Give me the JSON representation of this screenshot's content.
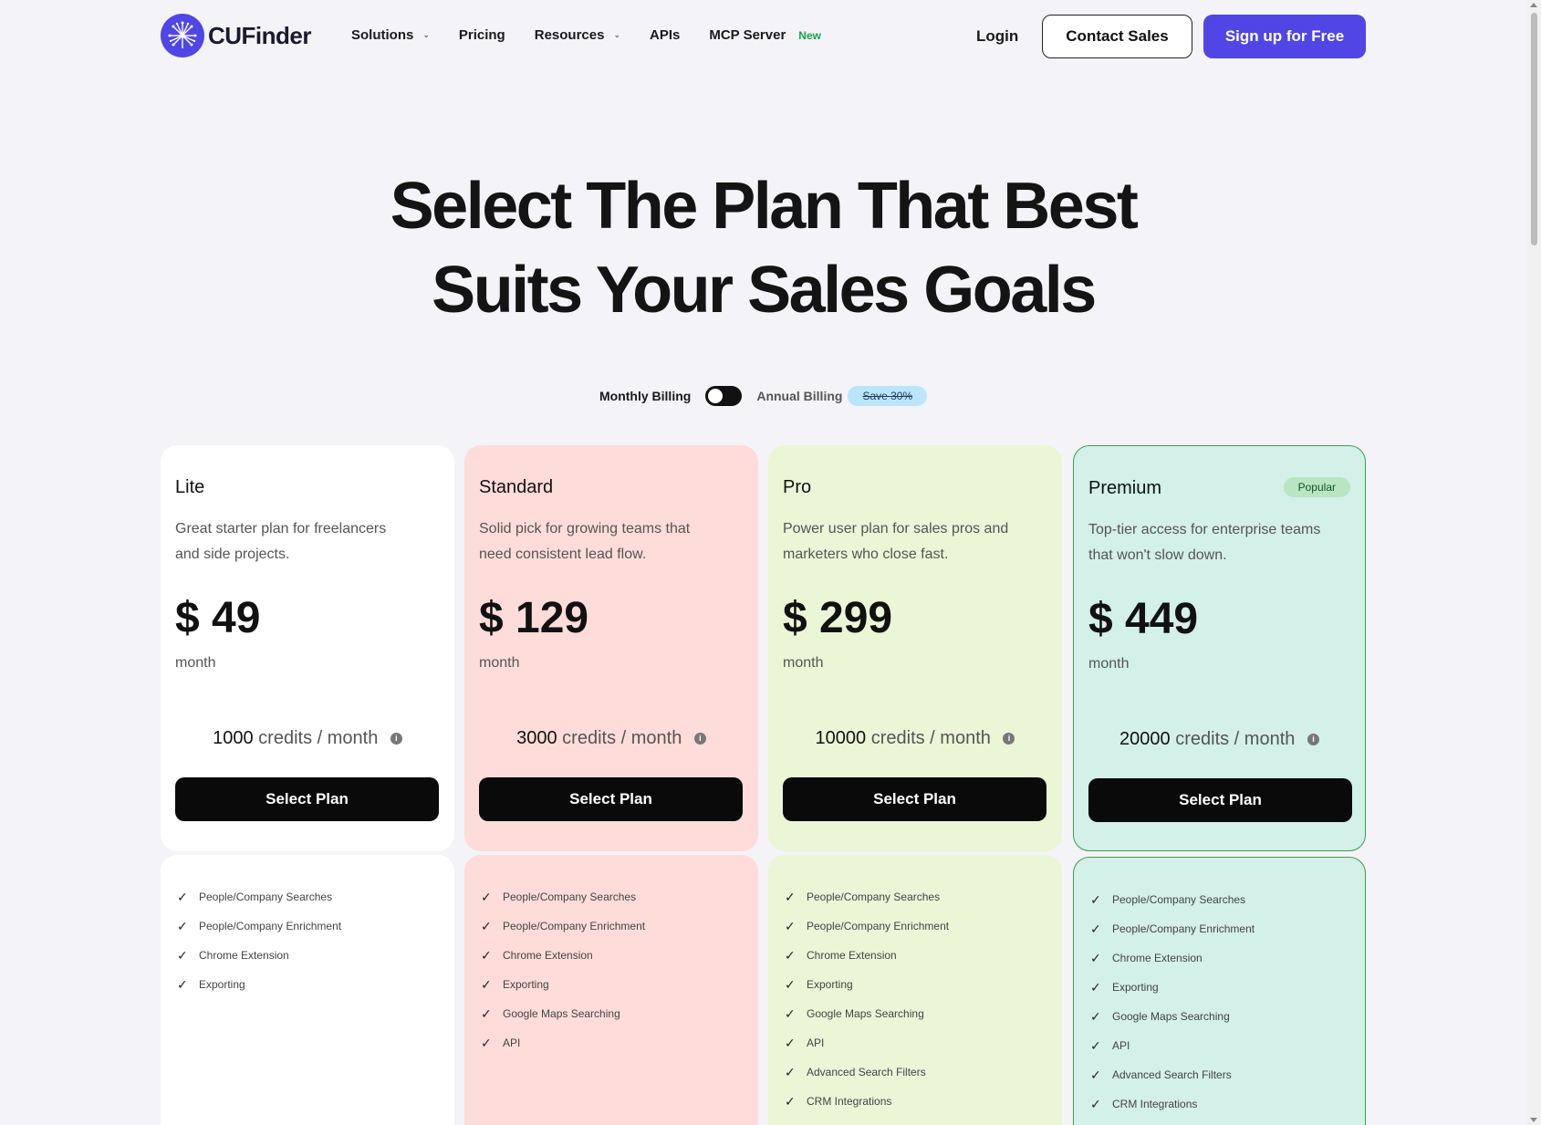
{
  "header": {
    "logo_text": "CUFinder",
    "nav": [
      {
        "label": "Solutions",
        "dropdown": true
      },
      {
        "label": "Pricing",
        "dropdown": false
      },
      {
        "label": "Resources",
        "dropdown": true
      },
      {
        "label": "APIs",
        "dropdown": false
      },
      {
        "label": "MCP Server",
        "dropdown": false,
        "badge": "New"
      }
    ],
    "login": "Login",
    "contact": "Contact Sales",
    "signup": "Sign up for Free"
  },
  "hero": {
    "line1": "Select The Plan That Best",
    "line2": "Suits Your Sales Goals"
  },
  "billing": {
    "monthly": "Monthly Billing",
    "annual": "Annual Billing",
    "save": "Save 30%",
    "annual_selected": false
  },
  "plans": [
    {
      "name": "Lite",
      "desc": "Great starter plan for freelancers and side projects.",
      "price": "$ 49",
      "period": "month",
      "credits_num": "1000",
      "credits_text": "credits / month",
      "button": "Select Plan",
      "features": [
        "People/Company Searches",
        "People/Company Enrichment",
        "Chrome Extension",
        "Exporting"
      ]
    },
    {
      "name": "Standard",
      "desc": "Solid pick for growing teams that need consistent lead flow.",
      "price": "$ 129",
      "period": "month",
      "credits_num": "3000",
      "credits_text": "credits / month",
      "button": "Select Plan",
      "features": [
        "People/Company Searches",
        "People/Company Enrichment",
        "Chrome Extension",
        "Exporting",
        "Google Maps Searching",
        "API"
      ]
    },
    {
      "name": "Pro",
      "desc": "Power user plan for sales pros and marketers who close fast.",
      "price": "$ 299",
      "period": "month",
      "credits_num": "10000",
      "credits_text": "credits / month",
      "button": "Select Plan",
      "features": [
        "People/Company Searches",
        "People/Company Enrichment",
        "Chrome Extension",
        "Exporting",
        "Google Maps Searching",
        "API",
        "Advanced Search Filters",
        "CRM Integrations"
      ]
    },
    {
      "name": "Premium",
      "badge": "Popular",
      "desc": "Top-tier access for enterprise teams that won't slow down.",
      "price": "$ 449",
      "period": "month",
      "credits_num": "20000",
      "credits_text": "credits / month",
      "button": "Select Plan",
      "features": [
        "People/Company Searches",
        "People/Company Enrichment",
        "Chrome Extension",
        "Exporting",
        "Google Maps Searching",
        "API",
        "Advanced Search Filters",
        "CRM Integrations"
      ]
    }
  ],
  "colors": {
    "accent": "#4f46e5",
    "lite_bg": "#ffffff",
    "standard_bg": "#fedcd9",
    "pro_bg": "#eaf6d6",
    "premium_bg": "#d3f0e9"
  }
}
